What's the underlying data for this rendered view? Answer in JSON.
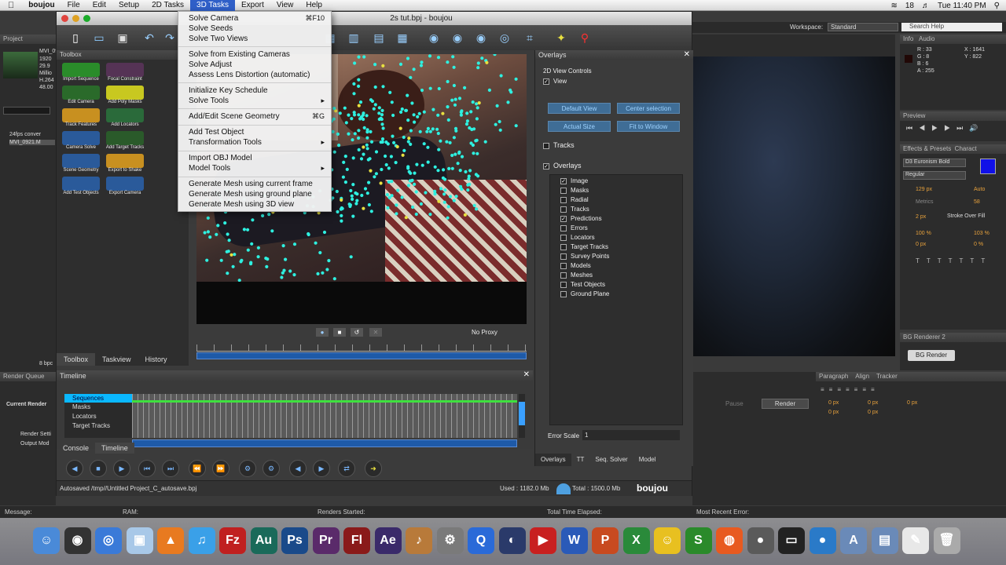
{
  "menubar": {
    "app": "boujou",
    "items": [
      "File",
      "Edit",
      "Setup",
      "2D Tasks",
      "3D Tasks",
      "Export",
      "View",
      "Help"
    ],
    "selected": "3D Tasks",
    "badge": "18",
    "clock": "Tue 11:40 PM"
  },
  "window": {
    "title": "2s tut.bpj - boujou"
  },
  "toolbox": {
    "title": "Toolbox",
    "tools": [
      "Import Sequence",
      "Focal Constraint",
      "Edit Camera",
      "Add Poly Masks",
      "Track Features",
      "Add Locators",
      "Camera Solve",
      "Add Target Tracks",
      "Scene Geometry",
      "Export to Shake",
      "Add Test Objects",
      "Export Camera"
    ],
    "tabs": [
      "Toolbox",
      "Taskview",
      "History"
    ]
  },
  "dropdown": {
    "items": [
      {
        "label": "Solve Camera",
        "shortcut": "⌘F10"
      },
      {
        "label": "Solve Seeds",
        "shortcut": ""
      },
      {
        "label": "Solve Two Views",
        "shortcut": ""
      },
      {
        "label": "Solve from Existing Cameras",
        "shortcut": ""
      },
      {
        "label": "Solve Adjust",
        "shortcut": ""
      },
      {
        "label": "Assess Lens Distortion (automatic)",
        "shortcut": ""
      },
      {
        "label": "Initialize Key Schedule",
        "shortcut": ""
      },
      {
        "label": "Solve Tools",
        "shortcut": "▸"
      },
      {
        "label": "Add/Edit Scene Geometry",
        "shortcut": "⌘G"
      },
      {
        "label": "Add Test Object",
        "shortcut": ""
      },
      {
        "label": "Transformation Tools",
        "shortcut": "▸"
      },
      {
        "label": "Import OBJ Model",
        "shortcut": ""
      },
      {
        "label": "Model Tools",
        "shortcut": "▸"
      },
      {
        "label": "Generate Mesh using current frame",
        "shortcut": ""
      },
      {
        "label": "Generate Mesh using ground plane",
        "shortcut": ""
      },
      {
        "label": "Generate Mesh using 3D view",
        "shortcut": ""
      }
    ]
  },
  "overlays": {
    "title": "Overlays",
    "controls": "2D View Controls",
    "view": "View",
    "buttons": [
      "Default View",
      "Center selection",
      "Actual Size",
      "Fit to Window"
    ],
    "tracks": "Tracks",
    "overlays_label": "Overlays",
    "items": [
      {
        "label": "Image",
        "checked": true
      },
      {
        "label": "Masks",
        "checked": false
      },
      {
        "label": "Radial",
        "checked": false
      },
      {
        "label": "Tracks",
        "checked": false
      },
      {
        "label": "Predictions",
        "checked": true
      },
      {
        "label": "Errors",
        "checked": false
      },
      {
        "label": "Locators",
        "checked": false
      },
      {
        "label": "Target Tracks",
        "checked": false
      },
      {
        "label": "Survey Points",
        "checked": false
      },
      {
        "label": "Models",
        "checked": false
      },
      {
        "label": "Meshes",
        "checked": false
      },
      {
        "label": "Test Objects",
        "checked": false
      },
      {
        "label": "Ground Plane",
        "checked": false
      }
    ],
    "error_scale_label": "Error Scale",
    "error_scale_value": "1",
    "tabs": [
      "Overlays",
      "TT",
      "Seq. Solver",
      "Model"
    ]
  },
  "viewer": {
    "proxy": "No Proxy"
  },
  "timeline": {
    "title": "Timeline",
    "layers": [
      "Sequences",
      "Masks",
      "Locators",
      "Target Tracks"
    ],
    "tabs": [
      "Console",
      "Timeline"
    ]
  },
  "status": {
    "autosave": "Autosaved /tmp//Untitled Project_C_autosave.bpj",
    "used": "Used : 1182.0 Mb",
    "total": "Total : 1500.0 Mb",
    "logo": "boujou"
  },
  "ae": {
    "project": "Project",
    "workspace_label": "Workspace:",
    "workspace_value": "Standard",
    "search": "Search Help",
    "info": "Info",
    "audio": "Audio",
    "info_vals": [
      "R : 33",
      "G : 8",
      "B : 6",
      "A : 255",
      "X : 1641",
      "Y : 822"
    ],
    "preview": "Preview",
    "effects": "Effects & Presets",
    "character": "Charact",
    "font_name": "D3 Euronism Bold",
    "font_style": "Regular",
    "font_size": "129 px",
    "leading": "Auto",
    "tracking_mode": "Metrics",
    "tracking_val": "58",
    "stroke": "2 px",
    "stroke_type": "Stroke Over Fill",
    "vscale": "100 %",
    "hscale": "103 %",
    "baseline": "0 px",
    "tsume": "0 %",
    "bg_renderer": "BG Renderer 2",
    "bg_render_btn": "BG Render",
    "paragraph": "Paragraph",
    "align": "Align",
    "tracker": "Tracker",
    "para_vals": [
      "0 px",
      "0 px",
      "0 px",
      "0 px",
      "0 px"
    ],
    "render_queue": "Render Queue",
    "current_render": "Current Render",
    "render": "Render",
    "pause": "Pause",
    "render_settings": "Render Setti",
    "output_module": "Output Mod",
    "project_items": [
      "MVI_0921.MOV",
      "24fps conver",
      "MVI_0921.M"
    ],
    "project_meta": [
      "1920",
      "29.9",
      "Millio",
      "H.264",
      "48.00"
    ],
    "bpc": "8 bpc"
  },
  "statusbar": {
    "message": "Message:",
    "ram": "RAM:",
    "renders_started": "Renders Started:",
    "total_time": "Total Time Elapsed:",
    "recent_error": "Most Recent Error:"
  },
  "dock": {
    "apps": [
      "Finder",
      "Dashboard",
      "Safari",
      "Preview",
      "VLC",
      "iTunes",
      "FileZilla",
      "Au",
      "Ps",
      "Pr",
      "Fl",
      "Ae",
      "GarageBand",
      "System Preferences",
      "QuickTime",
      "Cinema 4D",
      "Media",
      "Word",
      "PowerPoint",
      "Excel",
      "Adium",
      "Snake",
      "Firefox",
      "Rec",
      "Terminal",
      "Globe",
      "Applications",
      "Documents",
      "TextEdit",
      "Trash"
    ]
  }
}
